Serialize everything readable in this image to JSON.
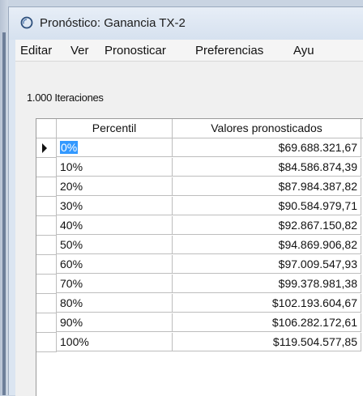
{
  "window": {
    "title": "Pronóstico: Ganancia TX-2",
    "icon": "crystal-ball-icon"
  },
  "menu": [
    {
      "label": "Editar"
    },
    {
      "label": "Ver"
    },
    {
      "label": "Pronosticar"
    },
    {
      "label": "Preferencias"
    },
    {
      "label": "Ayu"
    }
  ],
  "iterations_label": "1.000 Iteraciones",
  "table": {
    "columns": [
      "Percentil",
      "Valores pronosticados"
    ],
    "selected_row": 0,
    "rows": [
      {
        "percentile": "0%",
        "value": "$69.688.321,67"
      },
      {
        "percentile": "10%",
        "value": "$84.586.874,39"
      },
      {
        "percentile": "20%",
        "value": "$87.984.387,82"
      },
      {
        "percentile": "30%",
        "value": "$90.584.979,71"
      },
      {
        "percentile": "40%",
        "value": "$92.867.150,82"
      },
      {
        "percentile": "50%",
        "value": "$94.869.906,82"
      },
      {
        "percentile": "60%",
        "value": "$97.009.547,93"
      },
      {
        "percentile": "70%",
        "value": "$99.378.981,38"
      },
      {
        "percentile": "80%",
        "value": "$102.193.604,67"
      },
      {
        "percentile": "90%",
        "value": "$106.282.172,61"
      },
      {
        "percentile": "100%",
        "value": "$119.504.577,85"
      }
    ]
  },
  "colors": {
    "selection": "#3399ff",
    "title_bar": "#dbe5f1"
  }
}
